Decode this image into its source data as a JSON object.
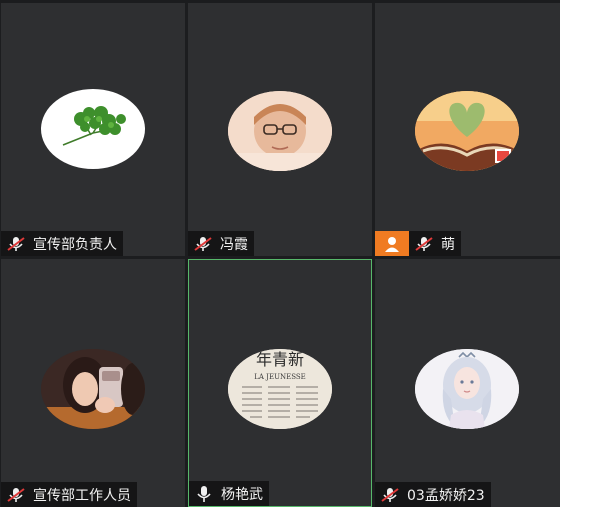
{
  "participants": [
    {
      "name": "宣传部负责人",
      "mic": "muted",
      "avatar": "coriander"
    },
    {
      "name": "冯霞",
      "mic": "muted",
      "avatar": "portrait-glasses"
    },
    {
      "name": "萌",
      "mic": "muted",
      "host": true,
      "avatar": "heart-book"
    },
    {
      "name": "宣传部工作人员",
      "mic": "muted",
      "avatar": "girl-selfie"
    },
    {
      "name": "杨艳武",
      "mic": "on",
      "active": true,
      "avatar": "newspaper",
      "avatar_text": {
        "headline": "年青新",
        "subtitle": "LA JEUNESSE"
      }
    },
    {
      "name": "03孟娇娇23",
      "mic": "muted",
      "avatar": "anime-girl"
    }
  ],
  "colors": {
    "tile": "#2e2f31",
    "active_border": "#57b86a",
    "host_badge": "#f07b22"
  }
}
